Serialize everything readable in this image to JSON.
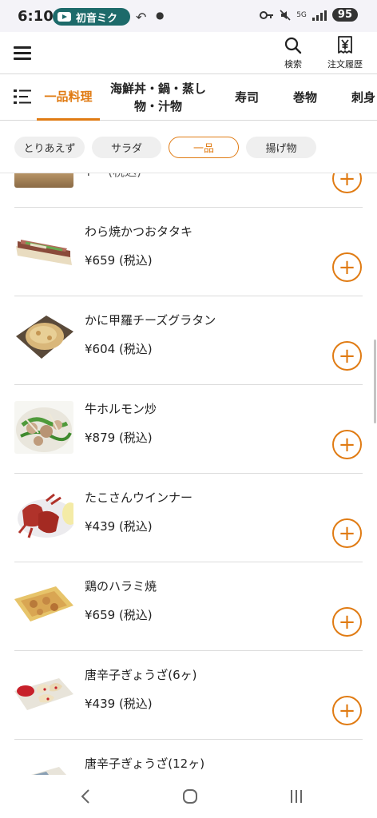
{
  "status_bar": {
    "time": "6:10",
    "notification_app": "初音ミク",
    "network_label": "5G",
    "battery": "95"
  },
  "header": {
    "search_label": "検索",
    "history_label": "注文履歴"
  },
  "tabs": [
    {
      "label": "一品料理",
      "active": true
    },
    {
      "label": "海鮮丼・鍋・蒸し物・汁物",
      "active": false
    },
    {
      "label": "寿司",
      "active": false
    },
    {
      "label": "巻物",
      "active": false
    },
    {
      "label": "刺身",
      "active": false
    }
  ],
  "chips": [
    {
      "label": "とりあえず",
      "active": false
    },
    {
      "label": "サラダ",
      "active": false
    },
    {
      "label": "一品",
      "active": true
    },
    {
      "label": "揚げ物",
      "active": false
    }
  ],
  "items": [
    {
      "name": "",
      "price": "¥⋯ (税込)"
    },
    {
      "name": "わら焼かつおタタキ",
      "price": "¥659 (税込)"
    },
    {
      "name": "かに甲羅チーズグラタン",
      "price": "¥604 (税込)"
    },
    {
      "name": "牛ホルモン炒",
      "price": "¥879 (税込)"
    },
    {
      "name": "たこさんウインナー",
      "price": "¥439 (税込)"
    },
    {
      "name": "鶏のハラミ焼",
      "price": "¥659 (税込)"
    },
    {
      "name": "唐辛子ぎょうざ(6ヶ)",
      "price": "¥439 (税込)"
    },
    {
      "name": "唐辛子ぎょうざ(12ヶ)",
      "price": ""
    }
  ],
  "add_symbol": "+",
  "colors": {
    "accent": "#e07b13",
    "pill": "#1d6a6a"
  }
}
